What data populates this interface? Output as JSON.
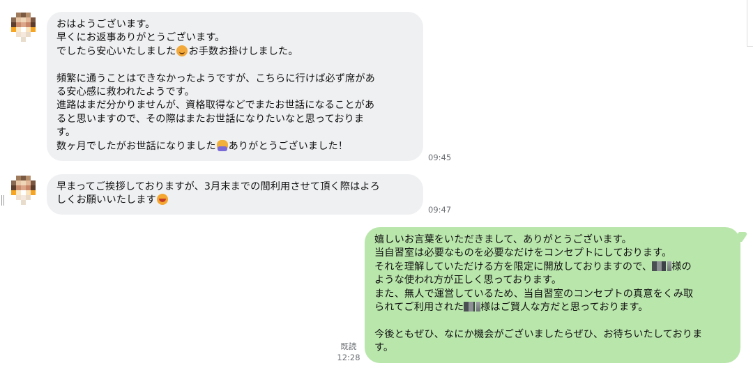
{
  "messages": {
    "m1": {
      "lines": [
        "おはようございます。",
        "早くにお返事ありがとうございます。",
        "でしたら安心いたしました",
        "お手数お掛けしました。",
        "",
        "頻繁に通うことはできなかったようですが、こちらに行けば必ず席があ",
        "る安心感に救われたようです。",
        "進路はまだ分かりませんが、資格取得などでまたお世話になることがあ",
        "ると思いますので、その際はまたお世話になりたいなと思っておりま",
        "す。",
        "数ヶ月でしたがお世話になりました",
        "ありがとうございました！"
      ],
      "time": "09:45"
    },
    "m2": {
      "lines": [
        "早まってご挨拶しておりますが、3月末までの間利用させて頂く際はよろ",
        "しくお願いいたします"
      ],
      "time": "09:47"
    },
    "m3": {
      "lines": [
        "嬉しいお言葉をいただきまして、ありがとうございます。",
        "当自習室は必要なものを必要なだけをコンセプトにしております。",
        "それを理解していただける方を限定に開放しておりますので、",
        "様の",
        "ような使われ方が正しく思っております。",
        "また、無人で運営しているため、当自習室のコンセプトの真意をくみ取",
        "られてご利用された",
        "様はご賢人な方だと思っております。",
        "",
        "今後ともぜひ、なにか機会がございましたらぜひ、お待ちいたしておりま",
        "す。"
      ],
      "read": "既読",
      "time": "12:28"
    }
  },
  "icons": {
    "emoji1": "relieved-face-emoji",
    "emoji2": "bowing-person-emoji",
    "emoji3": "smiling-face-emoji"
  },
  "colors": {
    "incoming_bubble": "#eff0f2",
    "outgoing_bubble": "#b9e6ab",
    "meta_text": "#6b6f74"
  }
}
